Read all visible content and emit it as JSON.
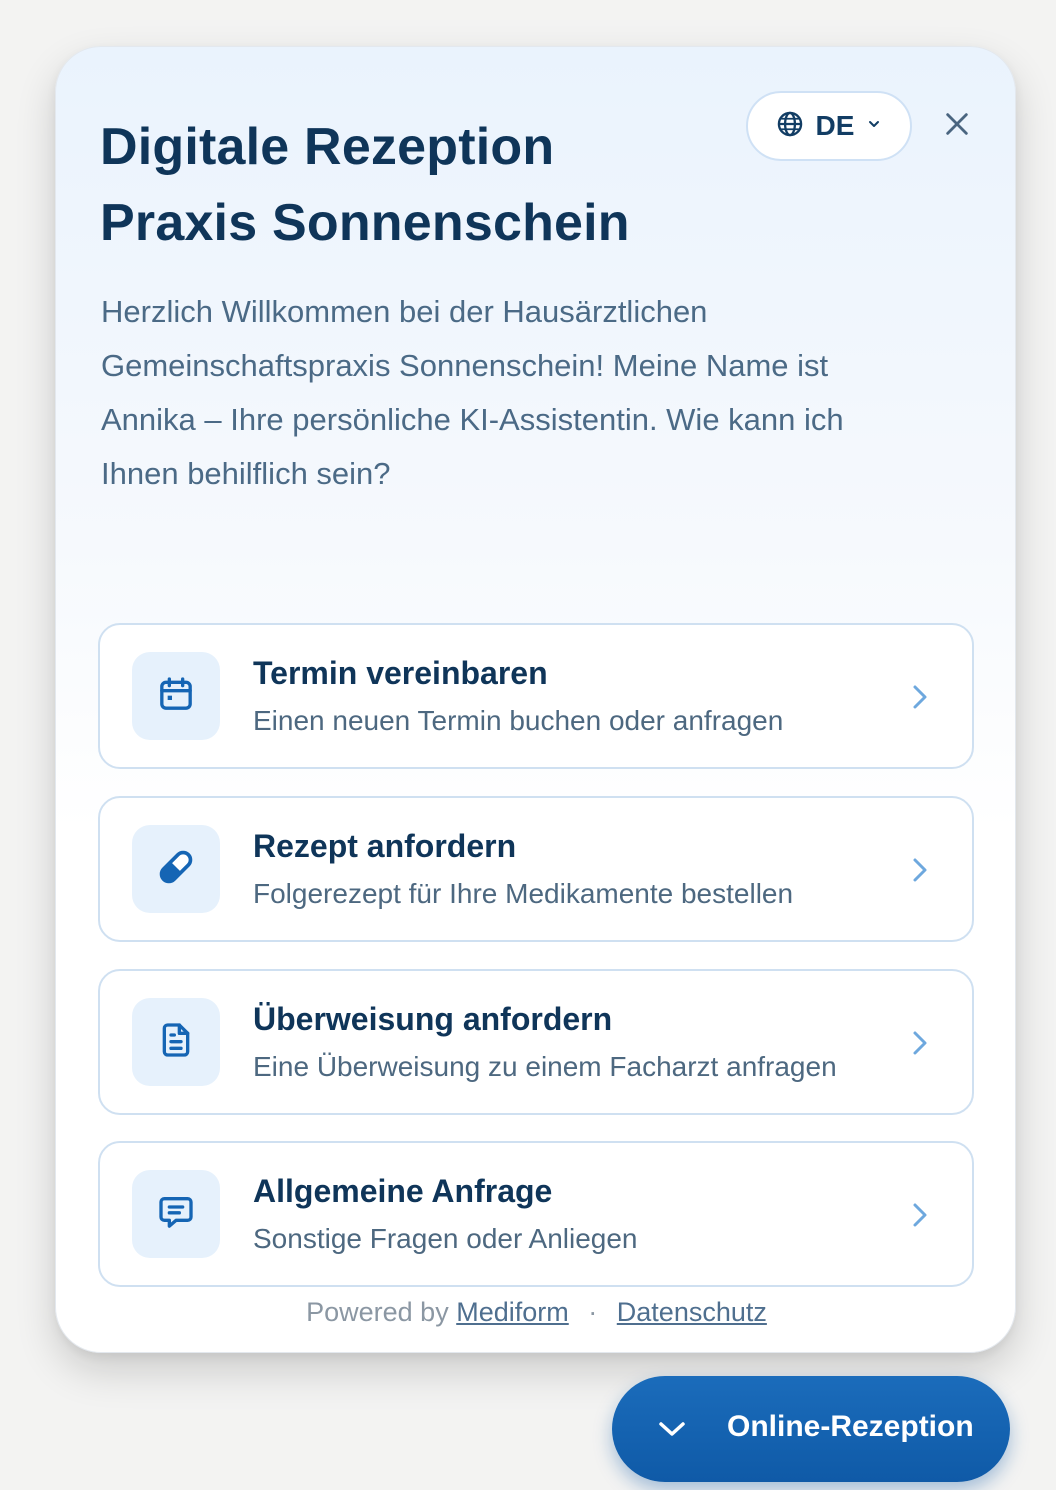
{
  "header": {
    "title_line1": "Digitale Rezeption",
    "title_line2": "Praxis Sonnenschein",
    "language": {
      "code": "DE",
      "icon": "globe-icon"
    },
    "close_icon": "close-icon"
  },
  "intro": "Herzlich Willkommen bei der Hausärztlichen Gemeinschaftspraxis Sonnenschein! Meine Name ist Annika – Ihre persönliche KI-Assistentin. Wie kann ich Ihnen behilflich sein?",
  "options": [
    {
      "title": "Termin vereinbaren",
      "subtitle": "Einen neuen Termin buchen oder anfragen",
      "icon": "calendar-icon"
    },
    {
      "title": "Rezept anfordern",
      "subtitle": "Folgerezept für Ihre Medikamente bestellen",
      "icon": "pill-icon"
    },
    {
      "title": "Überweisung anfordern",
      "subtitle": "Eine Überweisung zu einem Facharzt anfragen",
      "icon": "document-icon"
    },
    {
      "title": "Allgemeine Anfrage",
      "subtitle": "Sonstige Fragen oder Anliegen",
      "icon": "chat-icon"
    }
  ],
  "footer": {
    "powered_by": "Powered by",
    "brand_link": "Mediform",
    "separator": "·",
    "privacy_link": "Datenschutz"
  },
  "launcher": {
    "label": "Online-Rezeption",
    "icon": "chevron-down-icon"
  },
  "colors": {
    "accent": "#1565b4",
    "heading": "#0f3559",
    "icon_bg": "#e6f1fc",
    "border": "#cfe0f1"
  }
}
